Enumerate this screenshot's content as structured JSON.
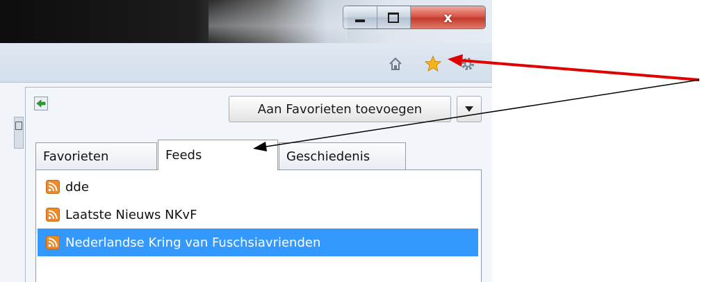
{
  "window": {
    "caption_buttons": [
      "minimize",
      "maximize",
      "close"
    ],
    "close_symbol": "x"
  },
  "toolbar": {
    "icons": [
      "home-icon",
      "favorites-star-icon",
      "tools-gear-icon"
    ],
    "star_color": "#f4b41a"
  },
  "favorites_panel": {
    "add_button_label": "Aan Favorieten toevoegen",
    "tabs": [
      {
        "label": "Favorieten",
        "active": false
      },
      {
        "label": "Feeds",
        "active": true
      },
      {
        "label": "Geschiedenis",
        "active": false
      }
    ],
    "feeds": [
      {
        "label": "dde",
        "selected": false
      },
      {
        "label": "Laatste Nieuws NKvF",
        "selected": false
      },
      {
        "label": "Nederlandse Kring van Fuschsiavrienden",
        "selected": true
      }
    ]
  },
  "annotations": {
    "arrow_colors": [
      "#e00000",
      "#000000"
    ]
  },
  "colors": {
    "selection": "#3399ff",
    "rss_orange": "#f08a24"
  }
}
